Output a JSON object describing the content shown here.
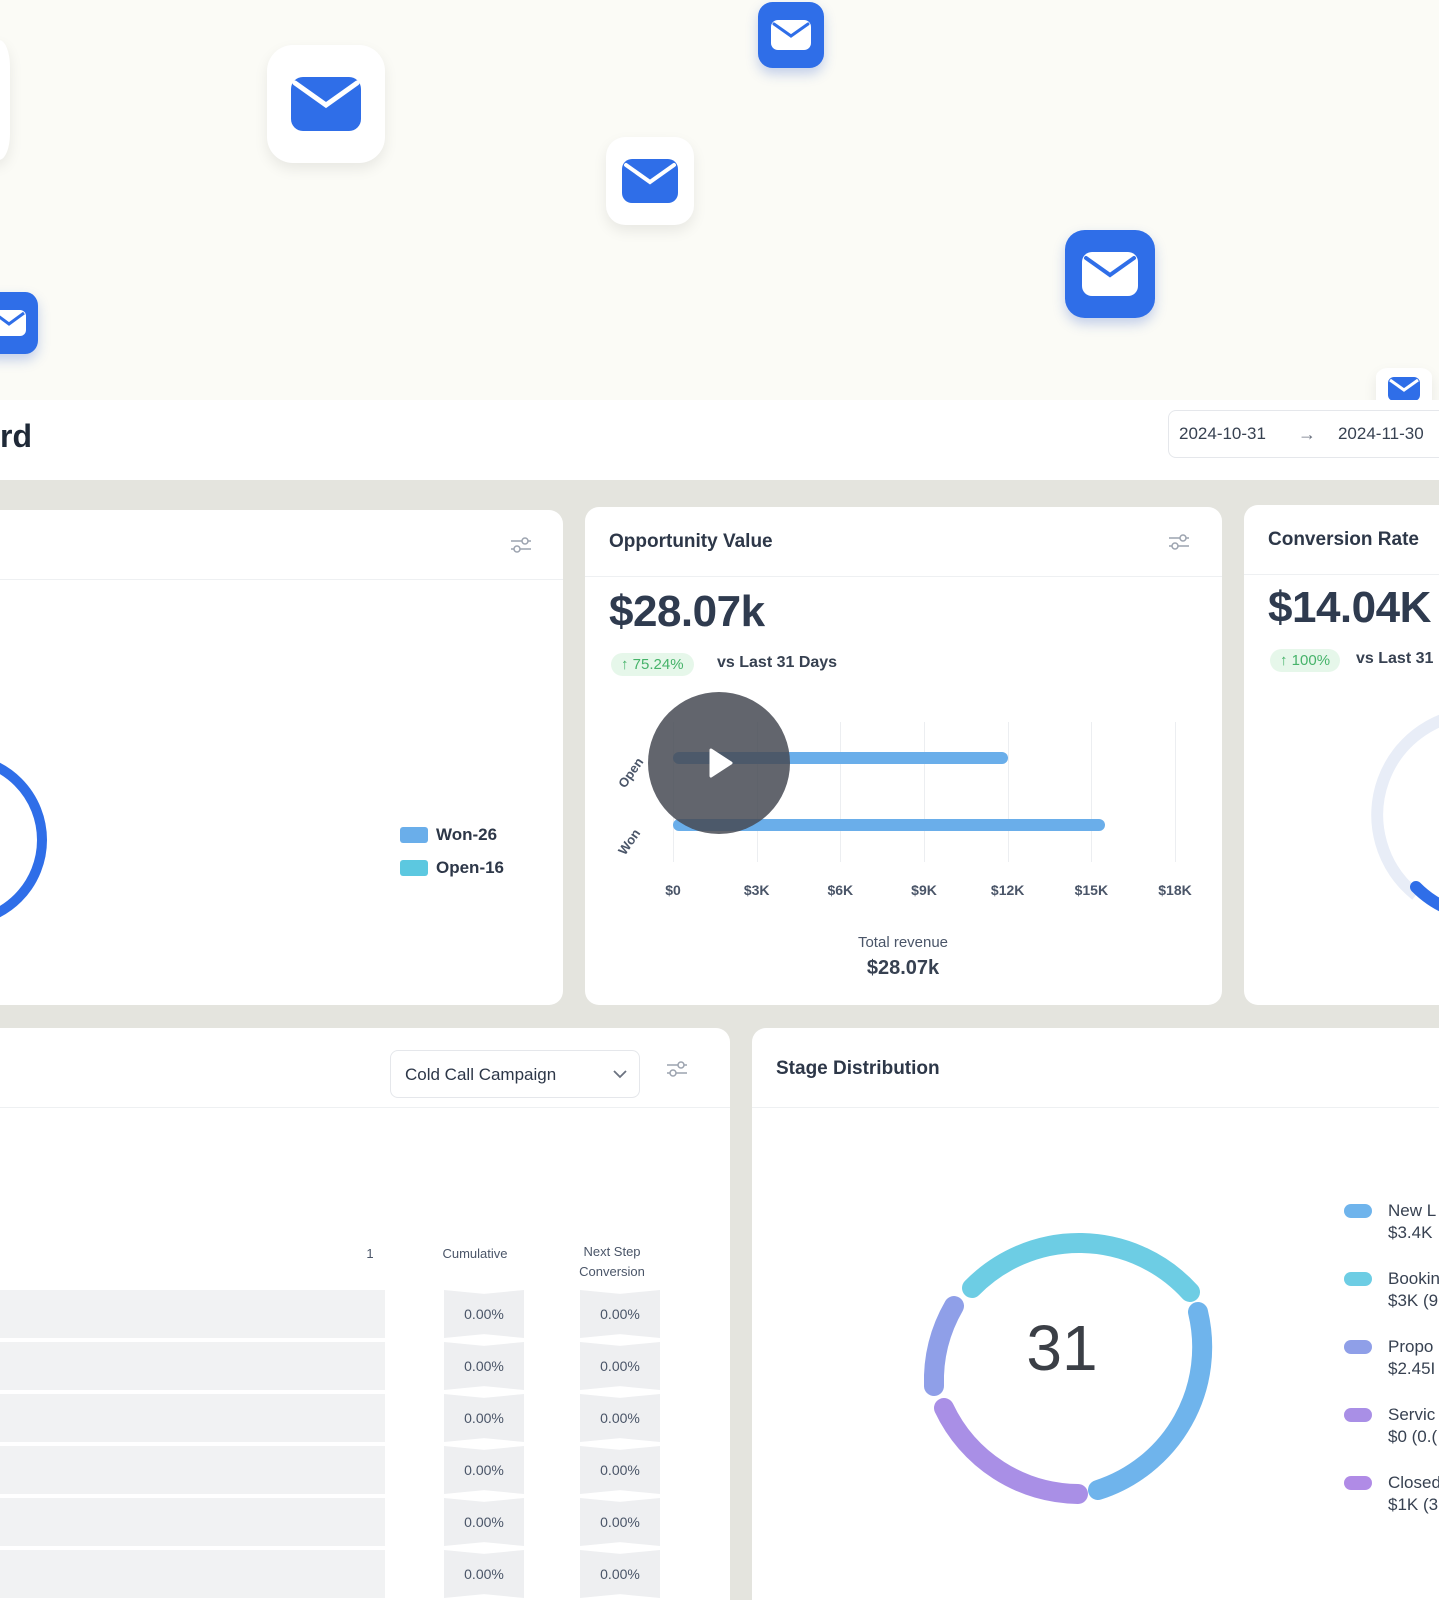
{
  "header": {
    "title_fragment": "rd",
    "date_start": "2024-10-31",
    "date_arrow": "→",
    "date_end": "2024-11-30"
  },
  "opportunity_status": {
    "legend": [
      {
        "label": "Won-26",
        "color": "#6aaeea"
      },
      {
        "label": "Open-16",
        "color": "#5cc8e0"
      }
    ]
  },
  "opportunity_value": {
    "title": "Opportunity Value",
    "value": "$28.07k",
    "change": "↑ 75.24%",
    "compare": "vs Last 31 Days",
    "total_label": "Total revenue",
    "total_value": "$28.07k"
  },
  "conversion_rate": {
    "title": "Conversion Rate",
    "value": "$14.04K",
    "change": "↑ 100%",
    "compare": "vs Last 31"
  },
  "funnel": {
    "campaign": "Cold Call Campaign",
    "col_partial": "1",
    "col_cumulative": "Cumulative",
    "col_next_1": "Next Step",
    "col_next_2": "Conversion",
    "rows": [
      {
        "cumulative": "0.00%",
        "next": "0.00%"
      },
      {
        "cumulative": "0.00%",
        "next": "0.00%"
      },
      {
        "cumulative": "0.00%",
        "next": "0.00%"
      },
      {
        "cumulative": "0.00%",
        "next": "0.00%"
      },
      {
        "cumulative": "0.00%",
        "next": "0.00%"
      },
      {
        "cumulative": "0.00%",
        "next": "0.00%"
      }
    ]
  },
  "stage_distribution": {
    "title": "Stage Distribution",
    "center": "31",
    "legend": [
      {
        "line1": "New L",
        "line2": "$3.4K",
        "color": "#6fb4ec"
      },
      {
        "line1": "Bookin",
        "line2": "$3K (9",
        "color": "#6dcde4"
      },
      {
        "line1": "Propo",
        "line2": "$2.45I",
        "color": "#8f9fe8"
      },
      {
        "line1": "Servic",
        "line2": "$0 (0.(",
        "color": "#a98fe6"
      },
      {
        "line1": "Closed",
        "line2": "$1K (3",
        "color": "#b08be6"
      }
    ]
  },
  "chart_data": {
    "type": "bar",
    "orientation": "horizontal",
    "categories": [
      "Open",
      "Won"
    ],
    "values": [
      12000,
      15500
    ],
    "x_ticks": [
      "$0",
      "$3K",
      "$6K",
      "$9K",
      "$12K",
      "$15K",
      "$18K"
    ],
    "xlim": [
      0,
      18000
    ],
    "grid": true
  }
}
